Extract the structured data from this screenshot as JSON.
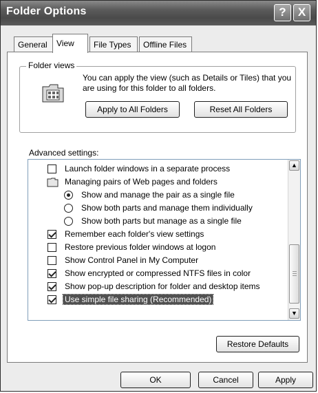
{
  "window": {
    "title": "Folder Options",
    "help_glyph": "?",
    "close_glyph": "X"
  },
  "tabs": [
    {
      "label": "General",
      "active": false
    },
    {
      "label": "View",
      "active": true
    },
    {
      "label": "File Types",
      "active": false
    },
    {
      "label": "Offline Files",
      "active": false
    }
  ],
  "folder_views": {
    "label": "Folder views",
    "description": "You can apply the view (such as Details or Tiles) that you are using for this folder to all folders.",
    "apply_button": "Apply to All Folders",
    "reset_button": "Reset All Folders",
    "icon": "folder-view-icon"
  },
  "advanced": {
    "label": "Advanced settings:",
    "items": [
      {
        "type": "checkbox",
        "label": "Launch folder windows in a separate process",
        "checked": false
      },
      {
        "type": "folder",
        "label": "Managing pairs of Web pages and folders"
      },
      {
        "type": "radio",
        "label": "Show and manage the pair as a single file",
        "checked": true
      },
      {
        "type": "radio",
        "label": "Show both parts and manage them individually",
        "checked": false
      },
      {
        "type": "radio",
        "label": "Show both parts but manage as a single file",
        "checked": false
      },
      {
        "type": "checkbox",
        "label": "Remember each folder's view settings",
        "checked": true
      },
      {
        "type": "checkbox",
        "label": "Restore previous folder windows at logon",
        "checked": false
      },
      {
        "type": "checkbox",
        "label": "Show Control Panel in My Computer",
        "checked": false
      },
      {
        "type": "checkbox",
        "label": "Show encrypted or compressed NTFS files in color",
        "checked": true
      },
      {
        "type": "checkbox",
        "label": "Show pop-up description for folder and desktop items",
        "checked": true
      },
      {
        "type": "checkbox",
        "label": "Use simple file sharing (Recommended)",
        "checked": true,
        "selected": true
      }
    ]
  },
  "restore_defaults_button": "Restore Defaults",
  "footer": {
    "ok": "OK",
    "cancel": "Cancel",
    "apply": "Apply"
  }
}
